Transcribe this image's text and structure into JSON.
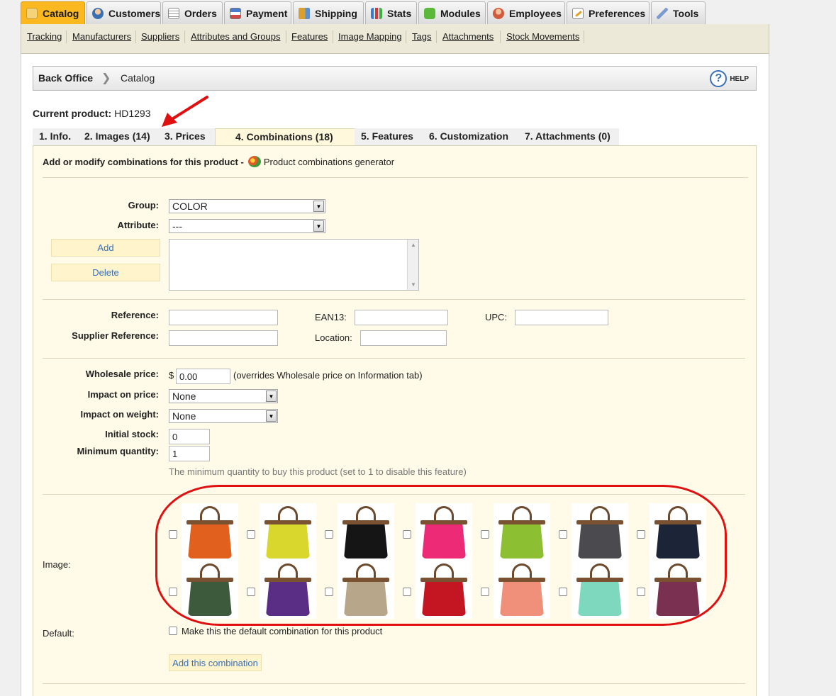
{
  "top_tabs": [
    {
      "label": "Catalog",
      "icon": "folder-icon"
    },
    {
      "label": "Customers",
      "icon": "customers-icon"
    },
    {
      "label": "Orders",
      "icon": "orders-icon"
    },
    {
      "label": "Payment",
      "icon": "payment-icon"
    },
    {
      "label": "Shipping",
      "icon": "shipping-icon"
    },
    {
      "label": "Stats",
      "icon": "stats-icon"
    },
    {
      "label": "Modules",
      "icon": "modules-icon"
    },
    {
      "label": "Employees",
      "icon": "employees-icon"
    },
    {
      "label": "Preferences",
      "icon": "preferences-icon"
    },
    {
      "label": "Tools",
      "icon": "tools-icon"
    }
  ],
  "subnav": [
    "Tracking",
    "Manufacturers",
    "Suppliers",
    "Attributes and Groups",
    "Features",
    "Image Mapping",
    "Tags",
    "Attachments",
    "Stock Movements"
  ],
  "breadcrumb": {
    "root": "Back Office",
    "current": "Catalog",
    "help": "HELP"
  },
  "current_product": {
    "label": "Current product:",
    "value": "HD1293"
  },
  "product_tabs": [
    "1. Info.",
    "2. Images (14)",
    "3. Prices",
    "4. Combinations (18)",
    "5. Features",
    "6. Customization",
    "7. Attachments (0)"
  ],
  "panel": {
    "heading": "Add or modify combinations for this product -",
    "generator": "Product combinations generator",
    "group_label": "Group:",
    "group_value": "COLOR",
    "attribute_label": "Attribute:",
    "attribute_value": "---",
    "add_button": "Add",
    "delete_button": "Delete",
    "reference_label": "Reference:",
    "ean13_label": "EAN13:",
    "upc_label": "UPC:",
    "supplier_ref_label": "Supplier Reference:",
    "location_label": "Location:",
    "wholesale_label": "Wholesale price:",
    "currency": "$",
    "wholesale_value": "0.00",
    "wholesale_note": "(overrides Wholesale price on Information tab)",
    "impact_price_label": "Impact on price:",
    "impact_price_value": "None",
    "impact_weight_label": "Impact on weight:",
    "impact_weight_value": "None",
    "initial_stock_label": "Initial stock:",
    "initial_stock_value": "0",
    "min_qty_label": "Minimum quantity:",
    "min_qty_value": "1",
    "min_qty_help": "The minimum quantity to buy this product (set to 1 to disable this feature)",
    "image_label": "Image:",
    "default_label": "Default:",
    "default_checkbox": "Make this the default combination for this product",
    "submit_button": "Add this combination"
  },
  "bag_colors": {
    "row1": [
      "#e2601e",
      "#d9d62e",
      "#151515",
      "#ec2a76",
      "#8cbf32",
      "#4a4a4f",
      "#1c2438"
    ],
    "row2": [
      "#3e5a3c",
      "#5b2e86",
      "#b8a68a",
      "#c41622",
      "#f0907a",
      "#7ed8be",
      "#7a3050"
    ]
  },
  "colors": {
    "accent_tab": "#fbb81f",
    "panel_bg": "#fffbe8",
    "annotation": "#e01010"
  }
}
